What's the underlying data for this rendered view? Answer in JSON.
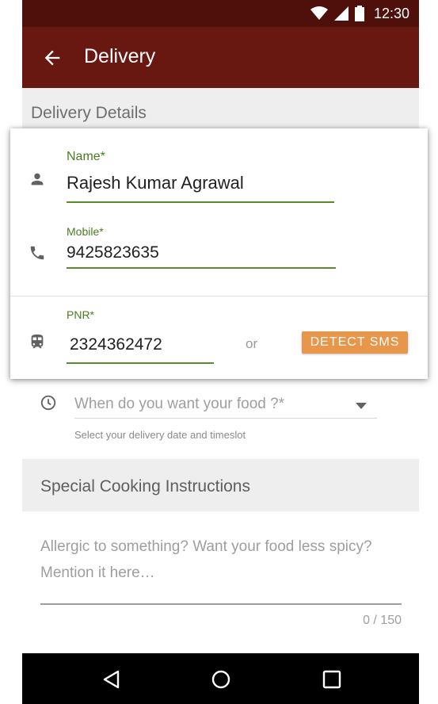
{
  "status_bar": {
    "time": "12:30",
    "icons": [
      "wifi-icon",
      "signal-icon",
      "battery-icon"
    ]
  },
  "app_bar": {
    "title": "Delivery",
    "back_icon": "arrow-back-icon"
  },
  "delivery_details": {
    "header": "Delivery Details",
    "name": {
      "label": "Name*",
      "value": "Rajesh Kumar Agrawal",
      "icon": "person-icon"
    },
    "mobile": {
      "label": "Mobile*",
      "value": "9425823635",
      "icon": "phone-icon"
    },
    "pnr": {
      "label": "PNR*",
      "value": "2324362472",
      "icon": "train-icon"
    },
    "or_text": "or",
    "detect_sms_label": "DETECT SMS"
  },
  "delivery_time": {
    "placeholder": "When do you want your food ?*",
    "helper": "Select your delivery date and timeslot",
    "icon": "clock-icon",
    "dropdown_icon": "dropdown-arrow-icon"
  },
  "special_instructions": {
    "header": "Special Cooking Instructions",
    "placeholder": "Allergic to something? Want your food less spicy? Mention it here…",
    "counter": "0 / 150"
  },
  "nav_bar": {
    "icons": [
      "back-triangle-icon",
      "home-circle-icon",
      "recents-square-icon"
    ]
  },
  "colors": {
    "status_bar": "#4f0f0b",
    "app_bar": "#681810",
    "accent_green": "#4a7d1f",
    "detect_button": "#e8964a"
  }
}
